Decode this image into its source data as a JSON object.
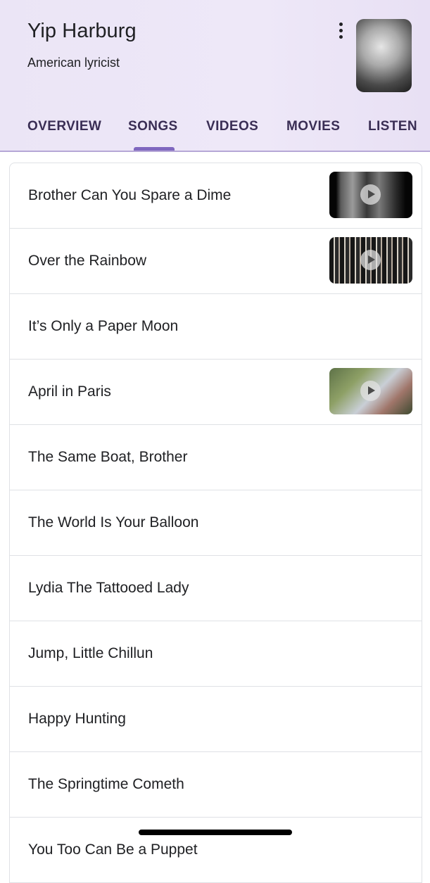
{
  "header": {
    "title": "Yip Harburg",
    "subtitle": "American lyricist"
  },
  "tabs": [
    "OVERVIEW",
    "SONGS",
    "VIDEOS",
    "MOVIES",
    "LISTEN"
  ],
  "active_tab": "SONGS",
  "songs": [
    {
      "title": "Brother Can You Spare a Dime",
      "has_video": true
    },
    {
      "title": "Over the Rainbow",
      "has_video": true
    },
    {
      "title": "It’s Only a Paper Moon",
      "has_video": false
    },
    {
      "title": "April in Paris",
      "has_video": true
    },
    {
      "title": "The Same Boat, Brother",
      "has_video": false
    },
    {
      "title": "The World Is Your Balloon",
      "has_video": false
    },
    {
      "title": "Lydia The Tattooed Lady",
      "has_video": false
    },
    {
      "title": "Jump, Little Chillun",
      "has_video": false
    },
    {
      "title": "Happy Hunting",
      "has_video": false
    },
    {
      "title": "The Springtime Cometh",
      "has_video": false
    },
    {
      "title": "You Too Can Be a Puppet",
      "has_video": false
    }
  ],
  "icons": {
    "menu": "more-vert-icon",
    "play": "play-icon"
  },
  "colors": {
    "header_bg": "#ebe5f6",
    "tab_text": "#3a2e55",
    "tab_indicator": "#7f67bf",
    "divider": "#dfe1e5"
  }
}
